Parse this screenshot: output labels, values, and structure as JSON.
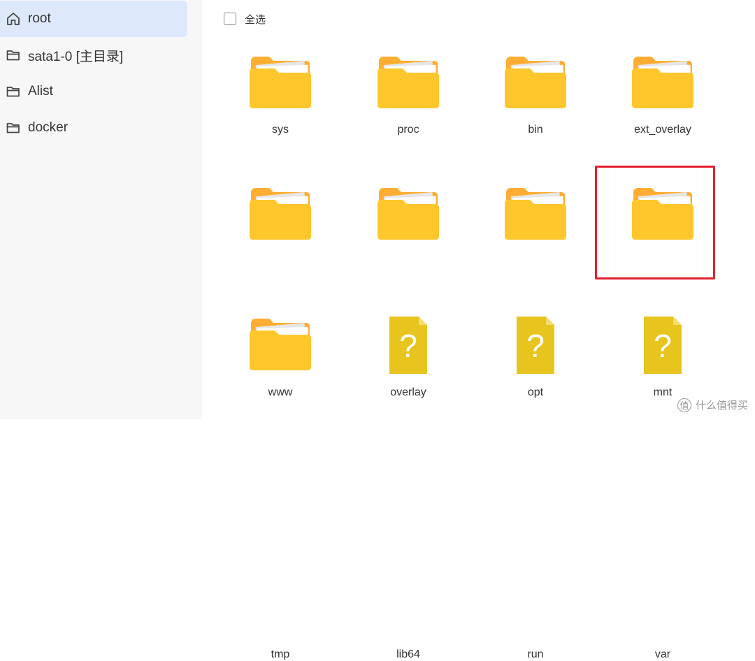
{
  "sidebar": {
    "items": [
      {
        "label": "root",
        "icon": "home-icon",
        "active": true
      },
      {
        "label": "sata1-0 [主目录]",
        "icon": "folder-outline-icon"
      },
      {
        "label": "Alist",
        "icon": "folder-outline-icon"
      },
      {
        "label": "docker",
        "icon": "folder-outline-icon"
      }
    ]
  },
  "toolbar": {
    "select_all_label": "全选",
    "select_all_checked": false
  },
  "files": [
    {
      "name": "sys",
      "type": "folder"
    },
    {
      "name": "proc",
      "type": "folder"
    },
    {
      "name": "bin",
      "type": "folder"
    },
    {
      "name": "ext_overlay",
      "type": "folder"
    },
    {
      "name": "www",
      "type": "folder"
    },
    {
      "name": "overlay",
      "type": "folder"
    },
    {
      "name": "opt",
      "type": "folder"
    },
    {
      "name": "mnt",
      "type": "folder",
      "highlighted": true
    },
    {
      "name": "tmp",
      "type": "folder"
    },
    {
      "name": "lib64",
      "type": "unknown-file"
    },
    {
      "name": "run",
      "type": "unknown-file"
    },
    {
      "name": "var",
      "type": "unknown-file"
    }
  ],
  "unknown_file_glyph": "?",
  "colors": {
    "folder_front": "#ffc72c",
    "folder_back": "#ffad33",
    "unknown_file": "#e8c41f",
    "active_item_bg": "#dde9fb",
    "highlight_border": "#e3202c"
  },
  "watermark": {
    "text": "什么值得买",
    "icon_char": "值"
  }
}
